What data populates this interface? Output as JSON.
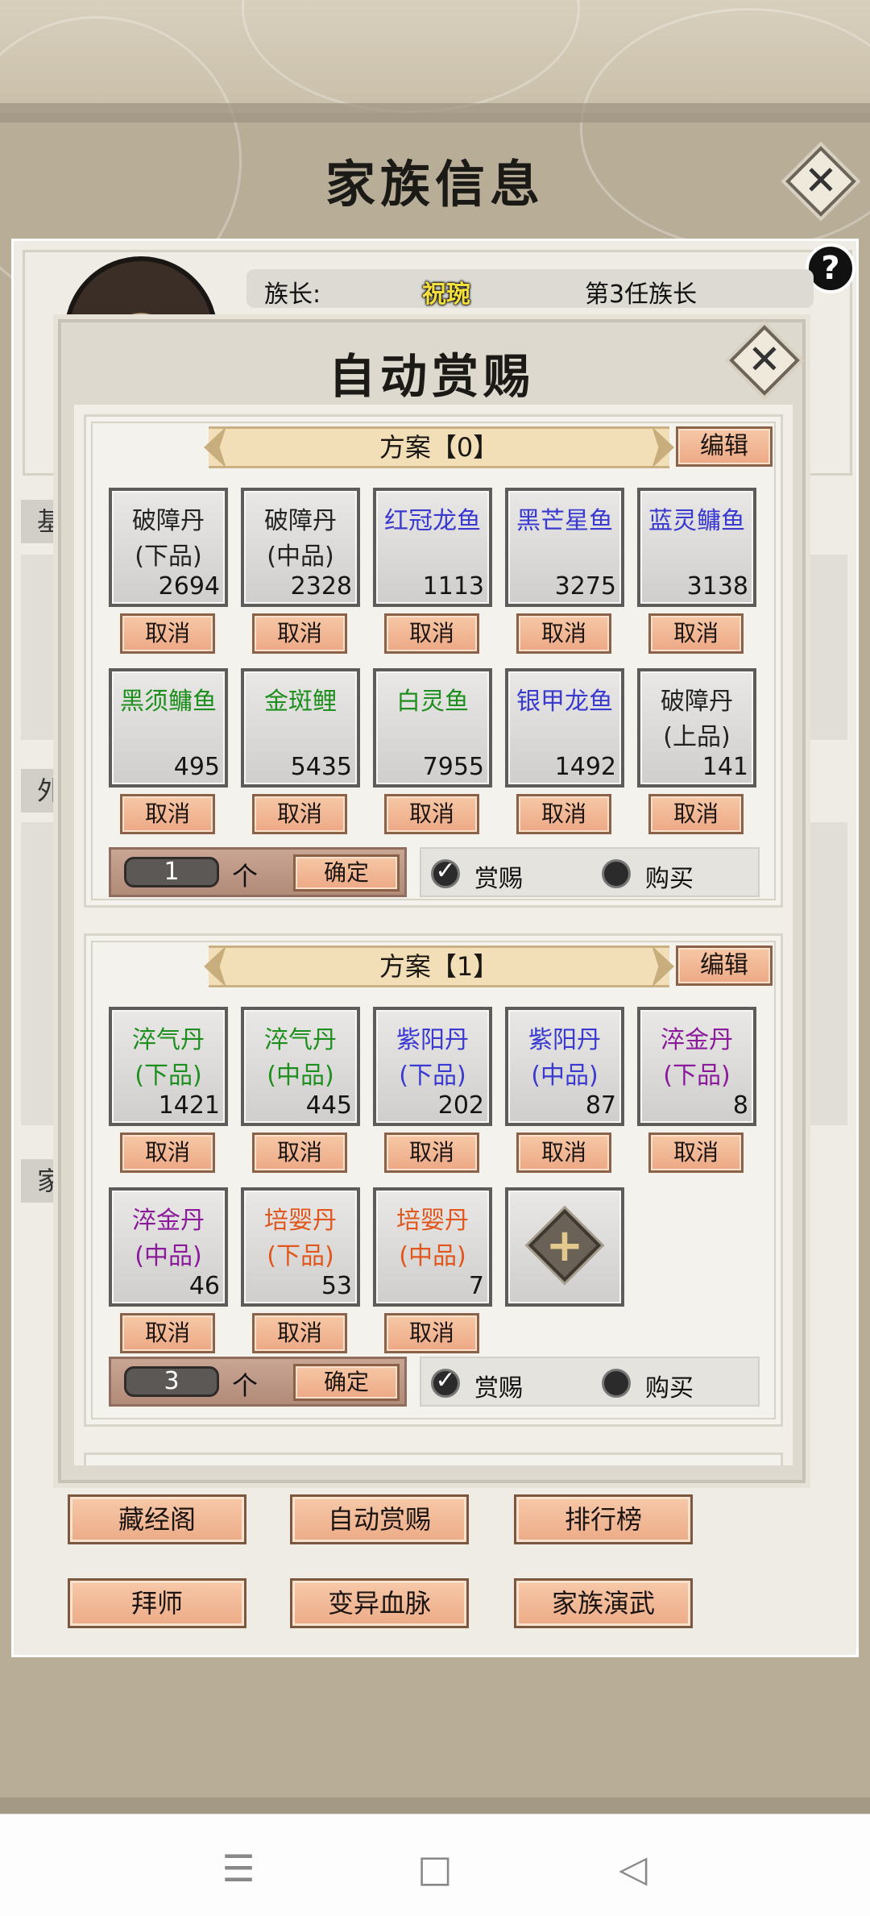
{
  "base": {
    "title": "家族信息",
    "leader_label": "族长:",
    "leader_name": "祝琬",
    "leader_term": "第3任族长",
    "side_tabs": [
      "基",
      "外",
      "家"
    ],
    "help_label": "?",
    "close_symbol": "✕",
    "actions": [
      "藏经阁",
      "自动赏赐",
      "排行榜",
      "拜师",
      "变异血脉",
      "家族演武"
    ]
  },
  "modal": {
    "title": "自动赏赐",
    "close_symbol": "✕"
  },
  "plans": [
    {
      "title": "方案【0】",
      "edit_label": "编辑",
      "items": [
        {
          "name": "破障丹\n(下品)",
          "count": "2694",
          "color": "#222222"
        },
        {
          "name": "破障丹\n(中品)",
          "count": "2328",
          "color": "#222222"
        },
        {
          "name": "红冠龙鱼",
          "count": "1113",
          "color": "#3a3ad0"
        },
        {
          "name": "黑芒星鱼",
          "count": "3275",
          "color": "#3a3ad0"
        },
        {
          "name": "蓝灵鳙鱼",
          "count": "3138",
          "color": "#3a3ad0"
        },
        {
          "name": "黑须鳙鱼",
          "count": "495",
          "color": "#1e8f1e"
        },
        {
          "name": "金斑鲤",
          "count": "5435",
          "color": "#1e8f1e"
        },
        {
          "name": "白灵鱼",
          "count": "7955",
          "color": "#1e8f1e"
        },
        {
          "name": "银甲龙鱼",
          "count": "1492",
          "color": "#3a3ad0"
        },
        {
          "name": "破障丹\n(上品)",
          "count": "141",
          "color": "#222222"
        }
      ],
      "cancel_label": "取消",
      "quantity": "1",
      "unit": "个",
      "confirm_label": "确定",
      "reward_label": "赏赐",
      "buy_label": "购买",
      "reward_checked": true,
      "check_symbol": "✓"
    },
    {
      "title": "方案【1】",
      "edit_label": "编辑",
      "items": [
        {
          "name": "淬气丹\n(下品)",
          "count": "1421",
          "color": "#1e8f1e"
        },
        {
          "name": "淬气丹\n(中品)",
          "count": "445",
          "color": "#1e8f1e"
        },
        {
          "name": "紫阳丹\n(下品)",
          "count": "202",
          "color": "#3a3ad0"
        },
        {
          "name": "紫阳丹\n(中品)",
          "count": "87",
          "color": "#3a3ad0"
        },
        {
          "name": "淬金丹\n(下品)",
          "count": "8",
          "color": "#8a1a9a"
        },
        {
          "name": "淬金丹\n(中品)",
          "count": "46",
          "color": "#8a1a9a"
        },
        {
          "name": "培婴丹\n(下品)",
          "count": "53",
          "color": "#e0561c"
        },
        {
          "name": "培婴丹\n(中品)",
          "count": "7",
          "color": "#e0561c"
        }
      ],
      "add_symbol": "+",
      "cancel_label": "取消",
      "quantity": "3",
      "unit": "个",
      "confirm_label": "确定",
      "reward_label": "赏赐",
      "buy_label": "购买",
      "reward_checked": true,
      "check_symbol": "✓"
    }
  ],
  "nav": {
    "menu_icon": "☰",
    "home_icon": "□",
    "back_icon": "◁"
  }
}
